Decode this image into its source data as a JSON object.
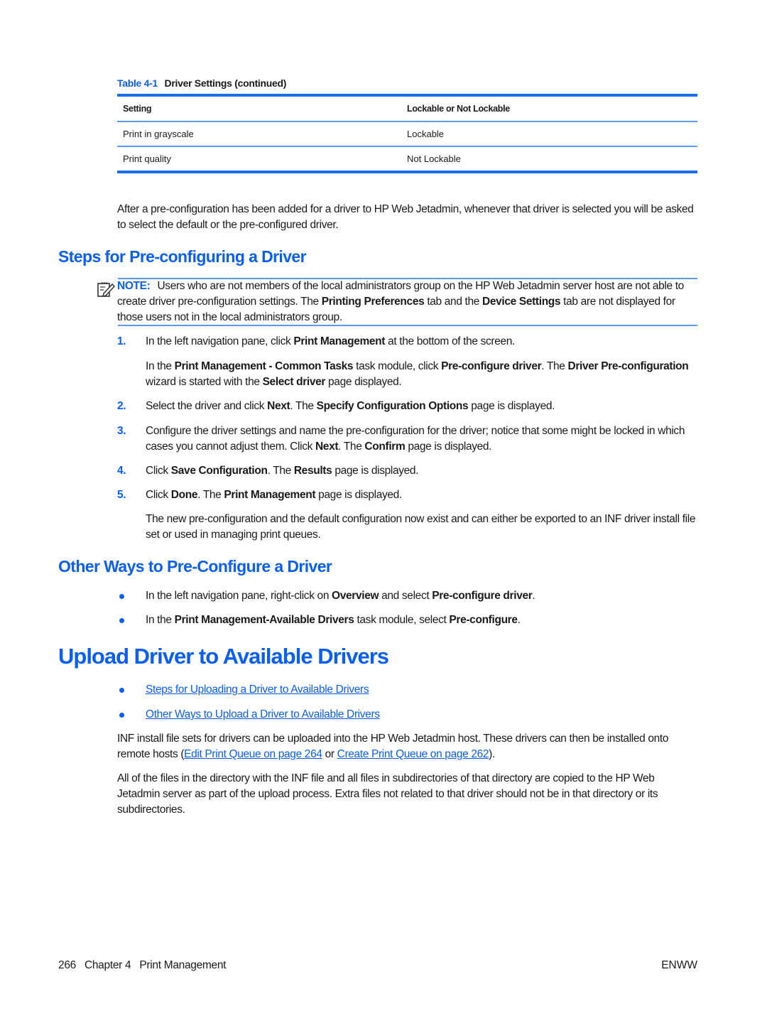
{
  "table": {
    "caption_number": "Table 4-1",
    "caption_title": "Driver Settings (continued)",
    "headers": [
      "Setting",
      "Lockable or Not Lockable"
    ],
    "rows": [
      [
        "Print in grayscale",
        "Lockable"
      ],
      [
        "Print quality",
        "Not Lockable"
      ]
    ]
  },
  "intro_paragraph": "After a pre-configuration has been added for a driver to HP Web Jetadmin, whenever that driver is selected you will be asked to select the default or the pre-configured driver.",
  "section1": {
    "heading": "Steps for Pre-configuring a Driver",
    "note": {
      "label": "NOTE:",
      "icon": "note-pencil-icon",
      "t1": "Users who are not members of the local administrators group on the HP Web Jetadmin server host are not able to create driver pre-configuration settings. The ",
      "b1": "Printing Preferences",
      "t2": " tab and the ",
      "b2": "Device Settings",
      "t3": " tab are not displayed for those users not in the local administrators group."
    },
    "steps": [
      {
        "number": "1.",
        "parts": [
          [
            "In the left navigation pane, click ",
            false
          ],
          [
            "Print Management",
            true
          ],
          [
            " at the bottom of the screen.",
            false
          ]
        ],
        "sub_parts": [
          [
            "In the ",
            false
          ],
          [
            "Print Management - Common Tasks",
            true
          ],
          [
            " task module, click ",
            false
          ],
          [
            "Pre-configure driver",
            true
          ],
          [
            ". The ",
            false
          ],
          [
            "Driver Pre-configuration",
            true
          ],
          [
            " wizard is started with the ",
            false
          ],
          [
            "Select driver",
            true
          ],
          [
            " page displayed.",
            false
          ]
        ]
      },
      {
        "number": "2.",
        "parts": [
          [
            "Select the driver and click ",
            false
          ],
          [
            "Next",
            true
          ],
          [
            ". The ",
            false
          ],
          [
            "Specify Configuration Options",
            true
          ],
          [
            " page is displayed.",
            false
          ]
        ]
      },
      {
        "number": "3.",
        "parts": [
          [
            "Configure the driver settings and name the pre-configuration for the driver; notice that some might be locked in which cases you cannot adjust them. Click ",
            false
          ],
          [
            "Next",
            true
          ],
          [
            ". The ",
            false
          ],
          [
            "Confirm",
            true
          ],
          [
            " page is displayed.",
            false
          ]
        ]
      },
      {
        "number": "4.",
        "parts": [
          [
            "Click ",
            false
          ],
          [
            "Save Configuration",
            true
          ],
          [
            ". The ",
            false
          ],
          [
            "Results",
            true
          ],
          [
            " page is displayed.",
            false
          ]
        ]
      },
      {
        "number": "5.",
        "parts": [
          [
            "Click ",
            false
          ],
          [
            "Done",
            true
          ],
          [
            ". The ",
            false
          ],
          [
            "Print Management",
            true
          ],
          [
            " page is displayed.",
            false
          ]
        ],
        "sub_parts": [
          [
            "The new pre-configuration and the default configuration now exist and can either be exported to an INF driver install file set or used in managing print queues.",
            false
          ]
        ]
      }
    ]
  },
  "section2": {
    "heading": "Other Ways to Pre-Configure a Driver",
    "bullets": [
      [
        [
          "In the left navigation pane, right-click on ",
          false
        ],
        [
          "Overview",
          true
        ],
        [
          " and select ",
          false
        ],
        [
          "Pre-configure driver",
          true
        ],
        [
          ".",
          false
        ]
      ],
      [
        [
          "In the ",
          false
        ],
        [
          "Print Management-Available Drivers",
          true
        ],
        [
          " task module, select ",
          false
        ],
        [
          "Pre-configure",
          true
        ],
        [
          ".",
          false
        ]
      ]
    ]
  },
  "section3": {
    "heading": "Upload Driver to Available Drivers",
    "links": [
      "Steps for Uploading a Driver to Available Drivers",
      "Other Ways to Upload a Driver to Available Drivers"
    ],
    "para1_t1": "INF install file sets for drivers can be uploaded into the HP Web Jetadmin host. These drivers can then be installed onto remote hosts (",
    "para1_link1": "Edit Print Queue on page 264",
    "para1_t2": " or ",
    "para1_link2": "Create Print Queue on page 262",
    "para1_t3": ").",
    "para2": "All of the files in the directory with the INF file and all files in subdirectories of that directory are copied to the HP Web Jetadmin server as part of the upload process. Extra files not related to that driver should not be in that directory or its subdirectories."
  },
  "footer": {
    "page_number": "266",
    "chapter": "Chapter 4",
    "chapter_title": "Print Management",
    "locale": "ENWW"
  },
  "colors": {
    "accent": "#0a5ef0",
    "rule": "#1a6ee8"
  }
}
